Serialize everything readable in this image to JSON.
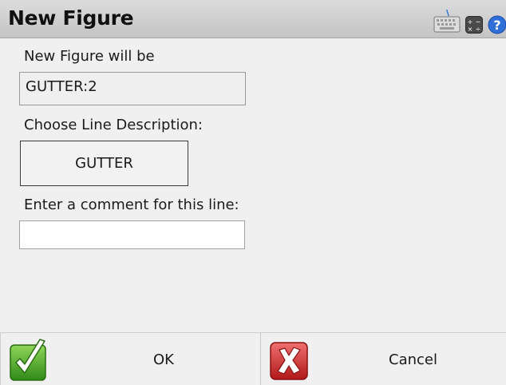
{
  "window": {
    "title": "New Figure"
  },
  "titlebar_icons": {
    "keyboard": "keyboard-icon",
    "calculator": "calculator-icon",
    "help": "help-icon"
  },
  "figure": {
    "label": "New Figure will be",
    "value": "GUTTER:2"
  },
  "line_description": {
    "label": "Choose Line Description:",
    "selected": "GUTTER"
  },
  "comment": {
    "label": "Enter a comment for this line:",
    "value": "",
    "placeholder": ""
  },
  "buttons": {
    "ok_label": "OK",
    "cancel_label": "Cancel"
  },
  "colors": {
    "ok_green": "#4aa520",
    "cancel_red": "#d42a2a",
    "titlebar": "#cfcfcf",
    "background": "#f0f0f0"
  }
}
